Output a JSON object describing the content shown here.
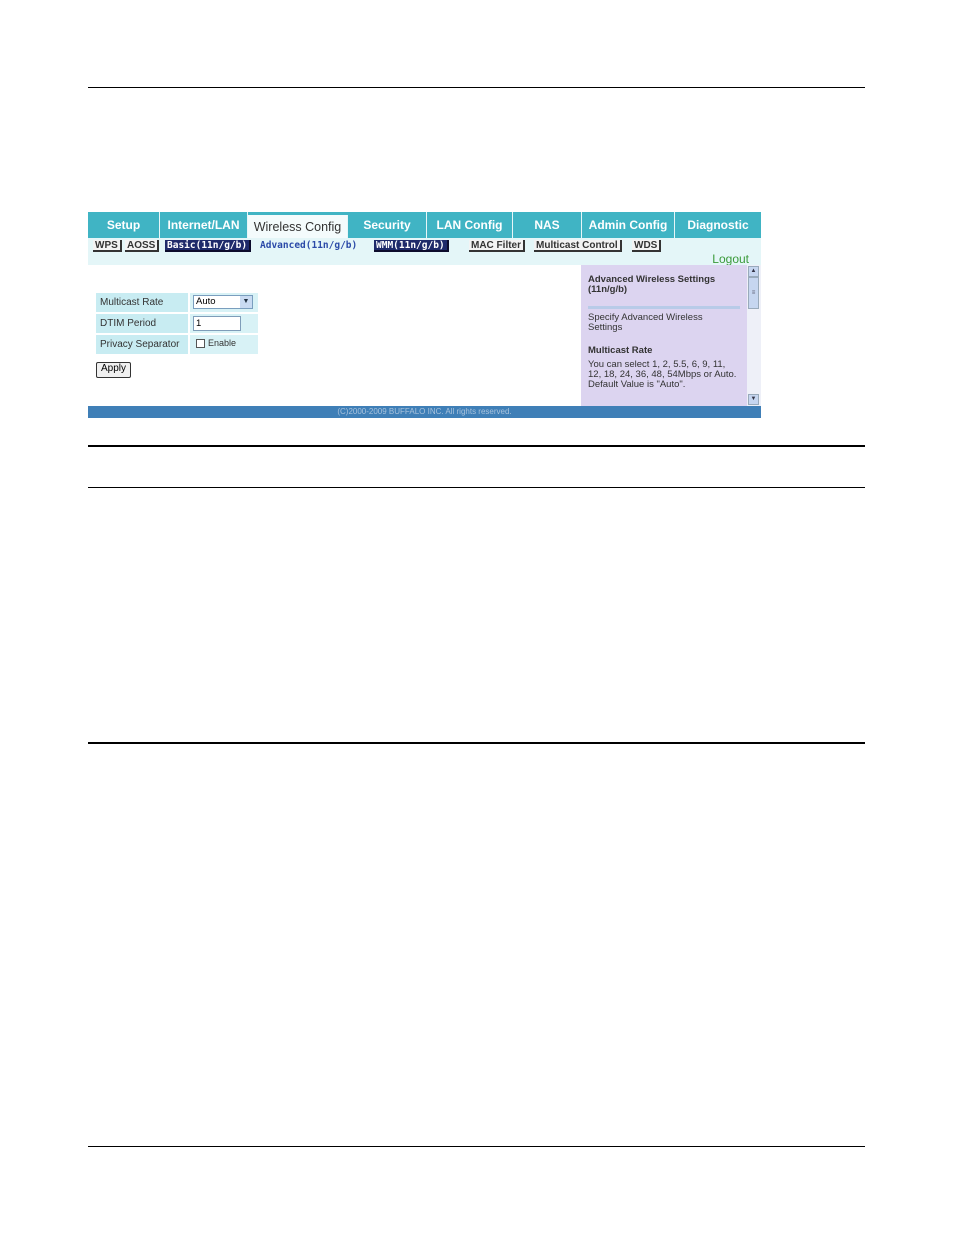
{
  "nav": {
    "tabs": [
      "Setup",
      "Internet/LAN",
      "Wireless Config",
      "Security",
      "LAN Config",
      "NAS",
      "Admin Config",
      "Diagnostic"
    ],
    "active_tab": "Wireless Config"
  },
  "subnav": {
    "items": [
      "WPS",
      "AOSS",
      "Basic(11n/g/b)",
      "Advanced(11n/g/b)",
      "WMM(11n/g/b)",
      "MAC Filter",
      "Multicast Control",
      "WDS"
    ],
    "current": "Advanced(11n/g/b)"
  },
  "logout_label": "Logout",
  "form": {
    "multicast_rate": {
      "label": "Multicast Rate",
      "value": "Auto"
    },
    "dtim_period": {
      "label": "DTIM Period",
      "value": "1"
    },
    "privacy_separator": {
      "label": "Privacy Separator",
      "checkbox_label": "Enable",
      "checked": false
    },
    "apply_label": "Apply"
  },
  "help": {
    "title": "Advanced Wireless Settings (11n/g/b)",
    "description": "Specify Advanced Wireless Settings",
    "section_heading": "Multicast Rate",
    "section_body": "You can select 1, 2, 5.5, 6, 9, 11, 12, 18, 24, 36, 48, 54Mbps or Auto.",
    "default_note": "Default Value is \"Auto\"."
  },
  "footer": "(C)2000-2009 BUFFALO INC. All rights reserved.",
  "colors": {
    "tab_bar": "#40b4c4",
    "subnav_bg": "#e4f6f8",
    "help_bg": "#dcd4f0",
    "footer_bg": "#3f7fb7",
    "logout": "#3a9a3a"
  }
}
